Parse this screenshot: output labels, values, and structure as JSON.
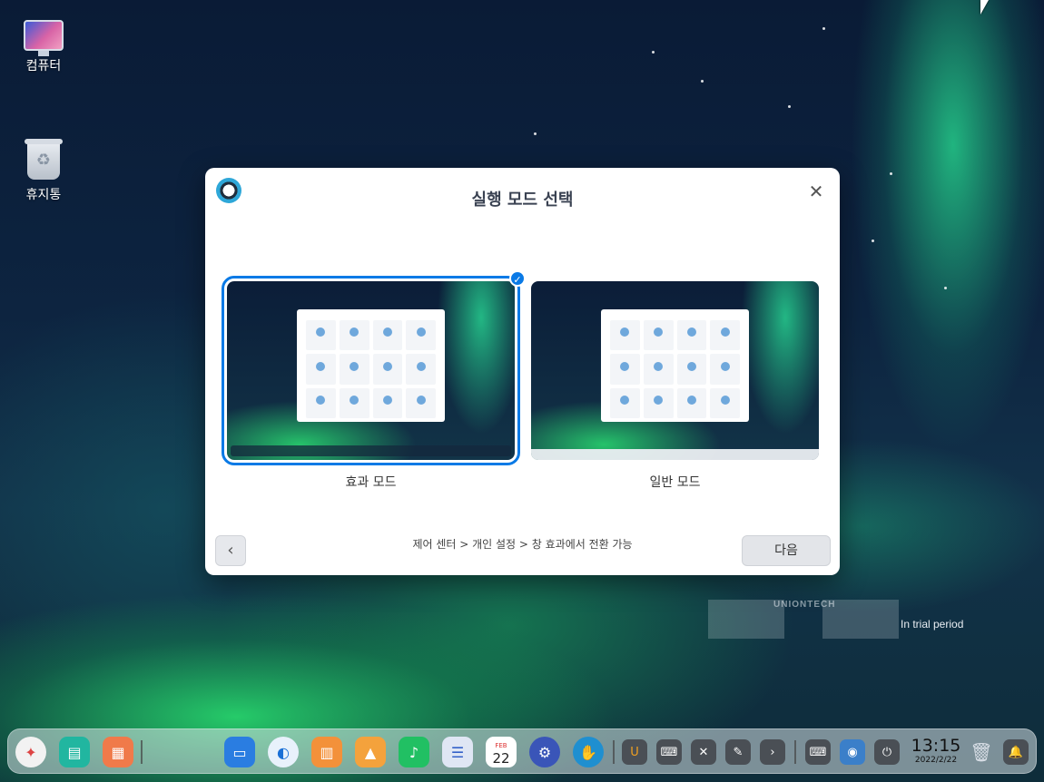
{
  "desktop": {
    "icons": [
      {
        "label": "컴퓨터",
        "icon": "computer-icon"
      },
      {
        "label": "휴지통",
        "icon": "trash-icon"
      }
    ]
  },
  "dialog": {
    "title": "실행 모드 선택",
    "close_icon": "close-icon",
    "modes": [
      {
        "label": "효과 모드",
        "selected": true
      },
      {
        "label": "일반 모드",
        "selected": false
      }
    ],
    "hint": "제어 센터 > 개인 설정 > 창 효과에서 전환 가능",
    "back_icon": "chevron-left-icon",
    "back_glyph": "‹",
    "next_label": "다음"
  },
  "watermark": {
    "brand": "UNIONTECH",
    "trial": "In trial period"
  },
  "dock": {
    "clock_time": "13:15",
    "clock_date": "2022/2/22",
    "calendar_day": "22",
    "calendar_month": "FEB",
    "apps": [
      "launcher-icon",
      "multitasking-icon",
      "app-store-icon",
      "file-manager-icon",
      "browser-icon",
      "shopping-bag-icon",
      "photos-icon",
      "music-icon",
      "contacts-icon",
      "calendar-icon",
      "settings-icon",
      "handshake-icon"
    ],
    "tray": [
      "u-app-icon",
      "keyboard-icon",
      "mute-icon",
      "pen-icon",
      "chevron-right-icon",
      "input-method-icon",
      "network-icon",
      "power-icon",
      "trash-icon",
      "notification-icon"
    ]
  },
  "colors": {
    "accent": "#0a7ae6",
    "dialog_bg": "#ffffff"
  }
}
